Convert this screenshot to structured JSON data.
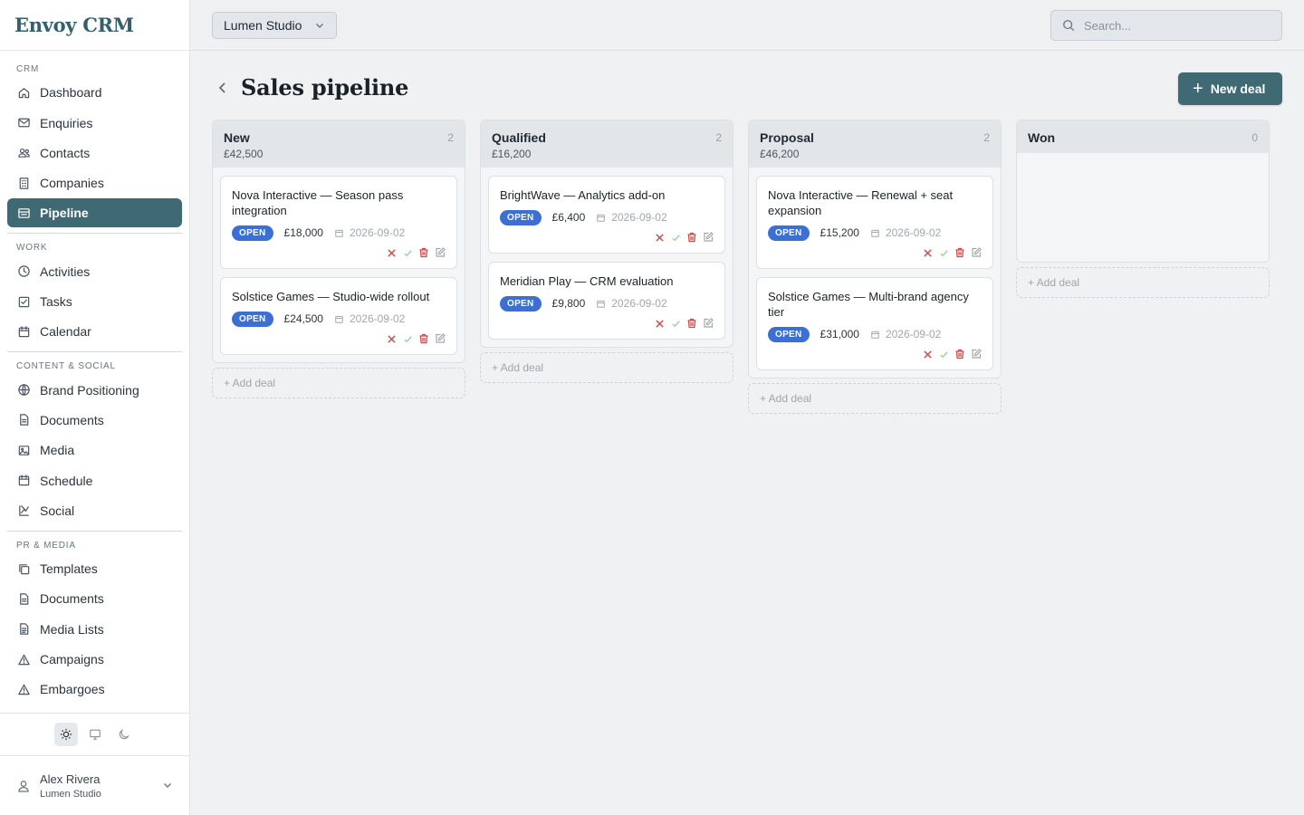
{
  "app": {
    "brand": "Envoy CRM"
  },
  "header": {
    "workspace": "Lumen Studio",
    "search_placeholder": "Search..."
  },
  "sidebar": {
    "sections": [
      {
        "label": "CRM",
        "items": [
          {
            "label": "Dashboard",
            "icon": "home-icon"
          },
          {
            "label": "Enquiries",
            "icon": "mail-icon"
          },
          {
            "label": "Contacts",
            "icon": "users-icon"
          },
          {
            "label": "Companies",
            "icon": "building-icon"
          },
          {
            "label": "Pipeline",
            "icon": "pipeline-icon",
            "active": true
          }
        ]
      },
      {
        "label": "WORK",
        "items": [
          {
            "label": "Activities",
            "icon": "clock-icon"
          },
          {
            "label": "Tasks",
            "icon": "checkbox-icon"
          },
          {
            "label": "Calendar",
            "icon": "calendar-icon"
          }
        ]
      },
      {
        "label": "CONTENT & SOCIAL",
        "items": [
          {
            "label": "Brand Positioning",
            "icon": "globe-icon"
          },
          {
            "label": "Documents",
            "icon": "document-icon"
          },
          {
            "label": "Media",
            "icon": "image-icon"
          },
          {
            "label": "Schedule",
            "icon": "calendar-icon"
          },
          {
            "label": "Social",
            "icon": "share-icon"
          }
        ]
      },
      {
        "label": "PR & MEDIA",
        "items": [
          {
            "label": "Templates",
            "icon": "copy-icon"
          },
          {
            "label": "Documents",
            "icon": "document-icon"
          },
          {
            "label": "Media Lists",
            "icon": "list-icon"
          },
          {
            "label": "Campaigns",
            "icon": "triangle-icon"
          },
          {
            "label": "Embargoes",
            "icon": "alert-icon"
          }
        ]
      }
    ],
    "theme": {
      "selected": "light",
      "options": [
        "light",
        "system",
        "dark"
      ]
    },
    "user": {
      "name": "Alex Rivera",
      "org": "Lumen Studio"
    }
  },
  "page": {
    "title": "Sales pipeline",
    "new_deal_label": "New deal",
    "add_deal_label": "+ Add deal"
  },
  "colors": {
    "accent": "#3f6a74",
    "badge": "#3b6fd4",
    "danger": "#d64545",
    "success": "#9bd1a5"
  },
  "columns": [
    {
      "name": "New",
      "total": "£42,500",
      "count": "2",
      "deals": [
        {
          "title": "Nova Interactive — Season pass integration",
          "status": "OPEN",
          "amount": "£18,000",
          "date": "2026-09-02"
        },
        {
          "title": "Solstice Games — Studio-wide rollout",
          "status": "OPEN",
          "amount": "£24,500",
          "date": "2026-09-02"
        }
      ]
    },
    {
      "name": "Qualified",
      "total": "£16,200",
      "count": "2",
      "deals": [
        {
          "title": "BrightWave — Analytics add-on",
          "status": "OPEN",
          "amount": "£6,400",
          "date": "2026-09-02"
        },
        {
          "title": "Meridian Play — CRM evaluation",
          "status": "OPEN",
          "amount": "£9,800",
          "date": "2026-09-02"
        }
      ]
    },
    {
      "name": "Proposal",
      "total": "£46,200",
      "count": "2",
      "deals": [
        {
          "title": "Nova Interactive — Renewal + seat expansion",
          "status": "OPEN",
          "amount": "£15,200",
          "date": "2026-09-02"
        },
        {
          "title": "Solstice Games — Multi-brand agency tier",
          "status": "OPEN",
          "amount": "£31,000",
          "date": "2026-09-02"
        }
      ]
    },
    {
      "name": "Won",
      "total": "",
      "count": "0",
      "deals": []
    }
  ]
}
